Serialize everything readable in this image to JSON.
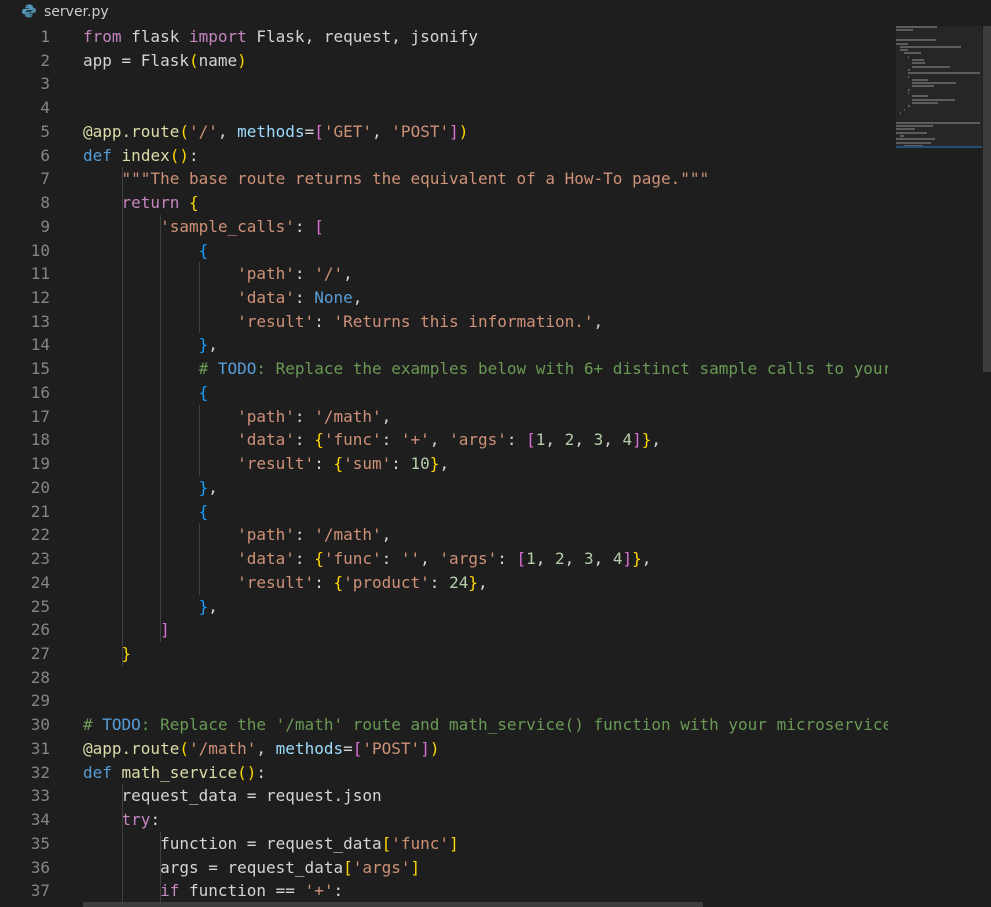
{
  "tab": {
    "filename": "server.py",
    "icon": "python-file-icon"
  },
  "colors": {
    "background": "#1e1e1e",
    "line_number": "#858585",
    "keyword": "#c586c0",
    "keyword_blue": "#569cd6",
    "function": "#dcdcaa",
    "variable": "#9cdcfe",
    "string": "#ce9178",
    "number": "#b5cea8",
    "comment": "#6a9955",
    "bracket_gold": "#ffd700",
    "bracket_orchid": "#da70d6",
    "bracket_blue": "#179fff"
  },
  "lines": [
    {
      "n": "1",
      "tokens": [
        [
          "kw",
          "from"
        ],
        [
          "plain",
          " flask "
        ],
        [
          "kw",
          "import"
        ],
        [
          "plain",
          " Flask, request, jsonify"
        ]
      ]
    },
    {
      "n": "2",
      "tokens": [
        [
          "plain",
          "app = Flask"
        ],
        [
          "b1",
          "("
        ],
        [
          "plain",
          "name"
        ],
        [
          "b1",
          ")"
        ]
      ]
    },
    {
      "n": "3",
      "tokens": []
    },
    {
      "n": "4",
      "tokens": []
    },
    {
      "n": "5",
      "tokens": [
        [
          "fn",
          "@app.route"
        ],
        [
          "b1",
          "("
        ],
        [
          "str",
          "'/'"
        ],
        [
          "plain",
          ", "
        ],
        [
          "var",
          "methods"
        ],
        [
          "plain",
          "="
        ],
        [
          "b2",
          "["
        ],
        [
          "str",
          "'GET'"
        ],
        [
          "plain",
          ", "
        ],
        [
          "str",
          "'POST'"
        ],
        [
          "b2",
          "]"
        ],
        [
          "b1",
          ")"
        ]
      ]
    },
    {
      "n": "6",
      "tokens": [
        [
          "kwb",
          "def"
        ],
        [
          "plain",
          " "
        ],
        [
          "fn",
          "index"
        ],
        [
          "b1",
          "("
        ],
        [
          "b1",
          ")"
        ],
        [
          "plain",
          ":"
        ]
      ]
    },
    {
      "n": "7",
      "tokens": [
        [
          "plain",
          "    "
        ],
        [
          "str",
          "\"\"\"The base route returns the equivalent of a How-To page.\"\"\""
        ]
      ]
    },
    {
      "n": "8",
      "tokens": [
        [
          "plain",
          "    "
        ],
        [
          "kw",
          "return"
        ],
        [
          "plain",
          " "
        ],
        [
          "b1",
          "{"
        ]
      ]
    },
    {
      "n": "9",
      "tokens": [
        [
          "plain",
          "        "
        ],
        [
          "str",
          "'sample_calls'"
        ],
        [
          "plain",
          ": "
        ],
        [
          "b2",
          "["
        ]
      ]
    },
    {
      "n": "10",
      "tokens": [
        [
          "plain",
          "            "
        ],
        [
          "b3",
          "{"
        ]
      ]
    },
    {
      "n": "11",
      "tokens": [
        [
          "plain",
          "                "
        ],
        [
          "str",
          "'path'"
        ],
        [
          "plain",
          ": "
        ],
        [
          "str",
          "'/'"
        ],
        [
          "plain",
          ","
        ]
      ]
    },
    {
      "n": "12",
      "tokens": [
        [
          "plain",
          "                "
        ],
        [
          "str",
          "'data'"
        ],
        [
          "plain",
          ": "
        ],
        [
          "kwb",
          "None"
        ],
        [
          "plain",
          ","
        ]
      ]
    },
    {
      "n": "13",
      "tokens": [
        [
          "plain",
          "                "
        ],
        [
          "str",
          "'result'"
        ],
        [
          "plain",
          ": "
        ],
        [
          "str",
          "'Returns this information.'"
        ],
        [
          "plain",
          ","
        ]
      ]
    },
    {
      "n": "14",
      "tokens": [
        [
          "plain",
          "            "
        ],
        [
          "b3",
          "}"
        ],
        [
          "plain",
          ","
        ]
      ]
    },
    {
      "n": "15",
      "tokens": [
        [
          "plain",
          "            "
        ],
        [
          "com",
          "# "
        ],
        [
          "todo",
          "TODO"
        ],
        [
          "com",
          ": Replace the examples below with 6+ distinct sample calls to your"
        ]
      ]
    },
    {
      "n": "16",
      "tokens": [
        [
          "plain",
          "            "
        ],
        [
          "b3",
          "{"
        ]
      ]
    },
    {
      "n": "17",
      "tokens": [
        [
          "plain",
          "                "
        ],
        [
          "str",
          "'path'"
        ],
        [
          "plain",
          ": "
        ],
        [
          "str",
          "'/math'"
        ],
        [
          "plain",
          ","
        ]
      ]
    },
    {
      "n": "18",
      "tokens": [
        [
          "plain",
          "                "
        ],
        [
          "str",
          "'data'"
        ],
        [
          "plain",
          ": "
        ],
        [
          "b1",
          "{"
        ],
        [
          "str",
          "'func'"
        ],
        [
          "plain",
          ": "
        ],
        [
          "str",
          "'+'"
        ],
        [
          "plain",
          ", "
        ],
        [
          "str",
          "'args'"
        ],
        [
          "plain",
          ": "
        ],
        [
          "b2",
          "["
        ],
        [
          "num",
          "1"
        ],
        [
          "plain",
          ", "
        ],
        [
          "num",
          "2"
        ],
        [
          "plain",
          ", "
        ],
        [
          "num",
          "3"
        ],
        [
          "plain",
          ", "
        ],
        [
          "num",
          "4"
        ],
        [
          "b2",
          "]"
        ],
        [
          "b1",
          "}"
        ],
        [
          "plain",
          ","
        ]
      ]
    },
    {
      "n": "19",
      "tokens": [
        [
          "plain",
          "                "
        ],
        [
          "str",
          "'result'"
        ],
        [
          "plain",
          ": "
        ],
        [
          "b1",
          "{"
        ],
        [
          "str",
          "'sum'"
        ],
        [
          "plain",
          ": "
        ],
        [
          "num",
          "10"
        ],
        [
          "b1",
          "}"
        ],
        [
          "plain",
          ","
        ]
      ]
    },
    {
      "n": "20",
      "tokens": [
        [
          "plain",
          "            "
        ],
        [
          "b3",
          "}"
        ],
        [
          "plain",
          ","
        ]
      ]
    },
    {
      "n": "21",
      "tokens": [
        [
          "plain",
          "            "
        ],
        [
          "b3",
          "{"
        ]
      ]
    },
    {
      "n": "22",
      "tokens": [
        [
          "plain",
          "                "
        ],
        [
          "str",
          "'path'"
        ],
        [
          "plain",
          ": "
        ],
        [
          "str",
          "'/math'"
        ],
        [
          "plain",
          ","
        ]
      ]
    },
    {
      "n": "23",
      "tokens": [
        [
          "plain",
          "                "
        ],
        [
          "str",
          "'data'"
        ],
        [
          "plain",
          ": "
        ],
        [
          "b1",
          "{"
        ],
        [
          "str",
          "'func'"
        ],
        [
          "plain",
          ": "
        ],
        [
          "str",
          "''"
        ],
        [
          "plain",
          ", "
        ],
        [
          "str",
          "'args'"
        ],
        [
          "plain",
          ": "
        ],
        [
          "b2",
          "["
        ],
        [
          "num",
          "1"
        ],
        [
          "plain",
          ", "
        ],
        [
          "num",
          "2"
        ],
        [
          "plain",
          ", "
        ],
        [
          "num",
          "3"
        ],
        [
          "plain",
          ", "
        ],
        [
          "num",
          "4"
        ],
        [
          "b2",
          "]"
        ],
        [
          "b1",
          "}"
        ],
        [
          "plain",
          ","
        ]
      ]
    },
    {
      "n": "24",
      "tokens": [
        [
          "plain",
          "                "
        ],
        [
          "str",
          "'result'"
        ],
        [
          "plain",
          ": "
        ],
        [
          "b1",
          "{"
        ],
        [
          "str",
          "'product'"
        ],
        [
          "plain",
          ": "
        ],
        [
          "num",
          "24"
        ],
        [
          "b1",
          "}"
        ],
        [
          "plain",
          ","
        ]
      ]
    },
    {
      "n": "25",
      "tokens": [
        [
          "plain",
          "            "
        ],
        [
          "b3",
          "}"
        ],
        [
          "plain",
          ","
        ]
      ]
    },
    {
      "n": "26",
      "tokens": [
        [
          "plain",
          "        "
        ],
        [
          "b2",
          "]"
        ]
      ]
    },
    {
      "n": "27",
      "tokens": [
        [
          "plain",
          "    "
        ],
        [
          "b1",
          "}"
        ]
      ]
    },
    {
      "n": "28",
      "tokens": []
    },
    {
      "n": "29",
      "tokens": []
    },
    {
      "n": "30",
      "tokens": [
        [
          "com",
          "# "
        ],
        [
          "todo",
          "TODO"
        ],
        [
          "com",
          ": Replace the '/math' route and math_service() function with your microservice"
        ]
      ]
    },
    {
      "n": "31",
      "tokens": [
        [
          "fn",
          "@app.route"
        ],
        [
          "b1",
          "("
        ],
        [
          "str",
          "'/math'"
        ],
        [
          "plain",
          ", "
        ],
        [
          "var",
          "methods"
        ],
        [
          "plain",
          "="
        ],
        [
          "b2",
          "["
        ],
        [
          "str",
          "'POST'"
        ],
        [
          "b2",
          "]"
        ],
        [
          "b1",
          ")"
        ]
      ]
    },
    {
      "n": "32",
      "tokens": [
        [
          "kwb",
          "def"
        ],
        [
          "plain",
          " "
        ],
        [
          "fn",
          "math_service"
        ],
        [
          "b1",
          "("
        ],
        [
          "b1",
          ")"
        ],
        [
          "plain",
          ":"
        ]
      ]
    },
    {
      "n": "33",
      "tokens": [
        [
          "plain",
          "    request_data = request.json"
        ]
      ]
    },
    {
      "n": "34",
      "tokens": [
        [
          "plain",
          "    "
        ],
        [
          "kw",
          "try"
        ],
        [
          "plain",
          ":"
        ]
      ]
    },
    {
      "n": "35",
      "tokens": [
        [
          "plain",
          "        function = request_data"
        ],
        [
          "b1",
          "["
        ],
        [
          "str",
          "'func'"
        ],
        [
          "b1",
          "]"
        ]
      ]
    },
    {
      "n": "36",
      "tokens": [
        [
          "plain",
          "        args = request_data"
        ],
        [
          "b1",
          "["
        ],
        [
          "str",
          "'args'"
        ],
        [
          "b1",
          "]"
        ]
      ]
    },
    {
      "n": "37",
      "tokens": [
        [
          "plain",
          "        "
        ],
        [
          "kw",
          "if"
        ],
        [
          "plain",
          " function == "
        ],
        [
          "str",
          "'+'"
        ],
        [
          "plain",
          ":"
        ]
      ]
    }
  ]
}
